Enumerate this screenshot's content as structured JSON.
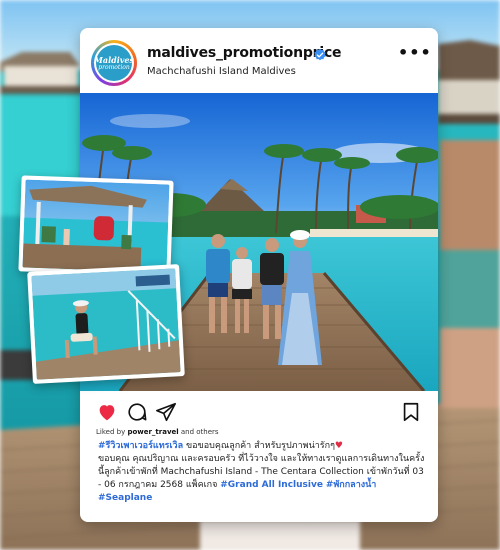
{
  "post": {
    "username": "maldives_promotionprice",
    "location": "Machchafushi Island Maldives",
    "more_label": "•••",
    "avatar": {
      "line1": "Maldives",
      "line2": "promotion"
    },
    "liked_by": {
      "prefix": "Liked by ",
      "user": "power_travel",
      "suffix": " and others"
    },
    "caption": {
      "hashtag_review": "#รีวิวเพาเวอร์แทรเวิล",
      "intro": " ขอขอบคุณลูกค้า สำหรับรูปภาพน่ารักๆ",
      "heart": "♥",
      "body": "ขอบคุณ คุณปริญาณ และครอบครัว ที่ไว้วางใจ และให้ทางเราดูแลการเดินทางในครั้งนี้ลูกค้าเข้าพักที่ Machchafushi Island - The Centara Collection เข้าพักวันที่ 03 - 06 กรกฎาคม 2568 แพ็คเกจ ",
      "hashtag_package": "#Grand All Inclusive",
      "hashtag_seaplane_1": "#พักกลางน้ำ",
      "hashtag_seaplane_2": "#Seaplane"
    }
  },
  "icons": {
    "verified": "verified-badge-icon",
    "like": "heart-icon",
    "comment": "comment-icon",
    "share": "paper-plane-icon",
    "save": "bookmark-icon"
  },
  "colors": {
    "accent_link": "#2e6bd6",
    "like_red": "#ed2a45",
    "verified_blue": "#3a8ff2",
    "sea": "#2ec2cf",
    "sky": "#1f7fe0"
  }
}
